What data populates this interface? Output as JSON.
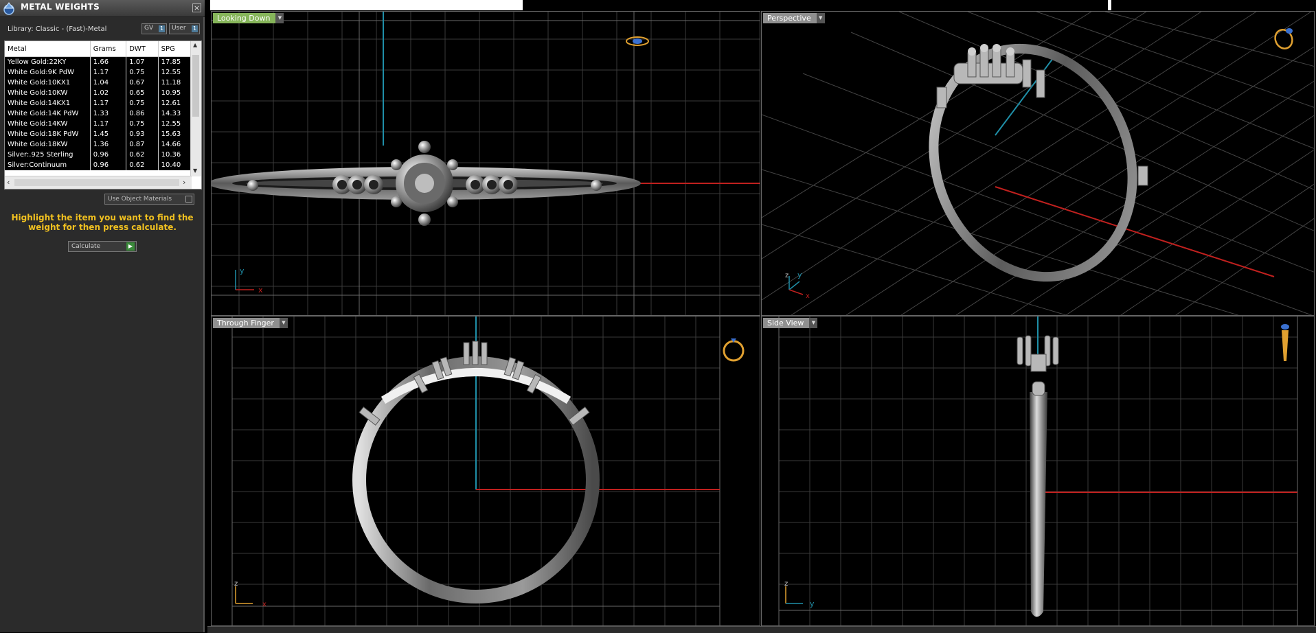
{
  "panel": {
    "title": "METAL WEIGHTS",
    "close_label": "×",
    "library": "Library: Classic - (Fast)-Metal",
    "gv_label": "GV",
    "user_label": "User",
    "indicator": "1",
    "table": {
      "headers": [
        "Metal",
        "Grams",
        "DWT",
        "SPG"
      ],
      "rows": [
        [
          "Yellow Gold:22KY",
          "1.66",
          "1.07",
          "17.85"
        ],
        [
          "White Gold:9K PdW",
          "1.17",
          "0.75",
          "12.55"
        ],
        [
          "White Gold:10KX1",
          "1.04",
          "0.67",
          "11.18"
        ],
        [
          "White Gold:10KW",
          "1.02",
          "0.65",
          "10.95"
        ],
        [
          "White Gold:14KX1",
          "1.17",
          "0.75",
          "12.61"
        ],
        [
          "White Gold:14K PdW",
          "1.33",
          "0.86",
          "14.33"
        ],
        [
          "White Gold:14KW",
          "1.17",
          "0.75",
          "12.55"
        ],
        [
          "White Gold:18K PdW",
          "1.45",
          "0.93",
          "15.63"
        ],
        [
          "White Gold:18KW",
          "1.36",
          "0.87",
          "14.66"
        ],
        [
          "Silver:.925 Sterling",
          "0.96",
          "0.62",
          "10.36"
        ],
        [
          "Silver:Continuum",
          "0.96",
          "0.62",
          "10.40"
        ]
      ]
    },
    "use_object_materials": "Use Object Materials",
    "hint": "Highlight the item you want to find the weight for then press calculate.",
    "calculate_label": "Calculate"
  },
  "viewports": {
    "top_left": {
      "label": "Looking Down",
      "axis_a": "y",
      "axis_b": "x"
    },
    "top_right": {
      "label": "Perspective",
      "axis_a": "z",
      "axis_b": "y",
      "axis_c": "x"
    },
    "bottom_left": {
      "label": "Through Finger",
      "axis_a": "z",
      "axis_b": "x"
    },
    "bottom_right": {
      "label": "Side View",
      "axis_a": "z",
      "axis_b": "y"
    }
  },
  "colors": {
    "active_tab": "#86b55a",
    "hint": "#f0c020",
    "axis_x": "#c0201e",
    "axis_y": "#1f8fa8"
  }
}
